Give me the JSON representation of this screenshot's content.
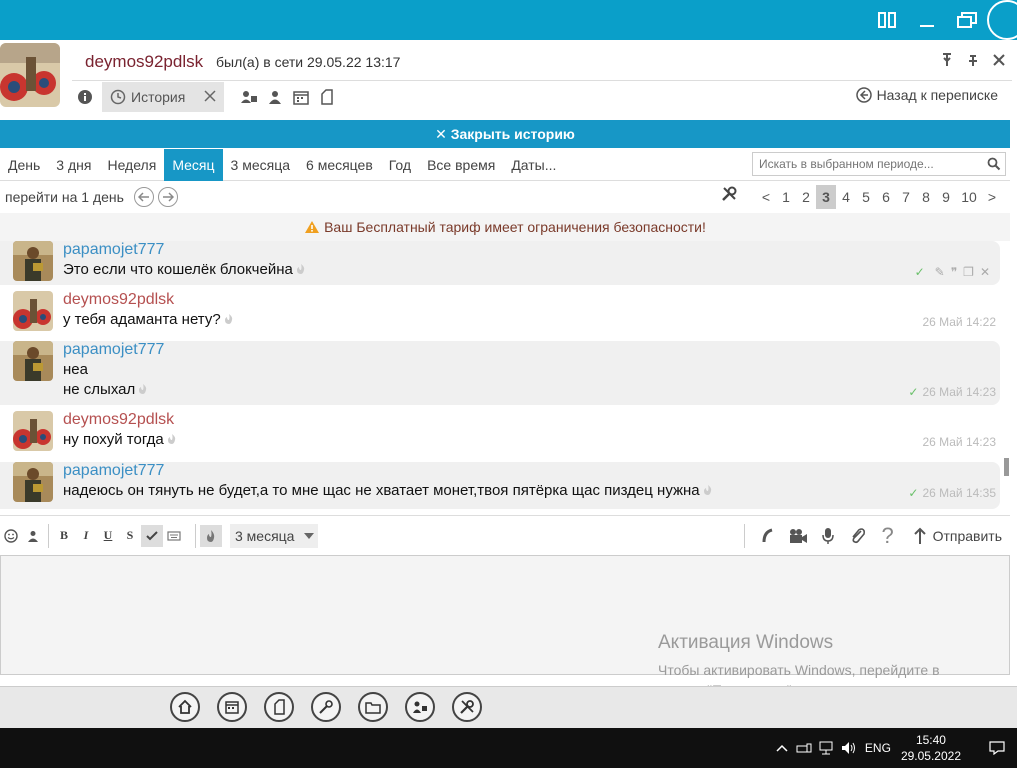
{
  "contact": {
    "name": "deymos92pdlsk",
    "status": "был(а) в сети 29.05.22 13:17"
  },
  "toolbar": {
    "history_tab": "История",
    "back_link": "Назад к переписке"
  },
  "history": {
    "close_label": "✕ Закрыть историю",
    "periods": [
      "День",
      "3 дня",
      "Неделя",
      "Месяц",
      "3 месяца",
      "6 месяцев",
      "Год",
      "Все время",
      "Даты..."
    ],
    "active_period": "Месяц",
    "search_placeholder": "Искать в выбранном периоде...",
    "goto_label": "перейти на 1 день",
    "pages": [
      "<",
      "1",
      "2",
      "3",
      "4",
      "5",
      "6",
      "7",
      "8",
      "9",
      "10",
      ">"
    ],
    "current_page": "3"
  },
  "warning": "Ваш Бесплатный тариф имеет ограничения безопасности!",
  "messages": [
    {
      "author": "papamojet777",
      "lines": [
        "Это если что кошелёк блокчейна"
      ],
      "time": "",
      "incoming": true
    },
    {
      "author": "deymos92pdlsk",
      "lines": [
        "у тебя адаманта нету?"
      ],
      "time": "26 Май 14:22",
      "incoming": false
    },
    {
      "author": "papamojet777",
      "lines": [
        "неа",
        "не слыхал"
      ],
      "time": "26 Май 14:23",
      "incoming": true
    },
    {
      "author": "deymos92pdlsk",
      "lines": [
        "ну похуй тогда"
      ],
      "time": "26 Май 14:23",
      "incoming": false
    },
    {
      "author": "papamojet777",
      "lines": [
        "надеюсь он тянуть не будет,а то мне щас не хватает монет,твоя пятёрка щас пиздец нужна"
      ],
      "time": "26 Май 14:35",
      "incoming": true
    }
  ],
  "composer": {
    "format_buttons": [
      "B",
      "I",
      "U",
      "S"
    ],
    "ttl_value": "3 месяца",
    "send_label": "Отправить"
  },
  "watermark": {
    "title": "Активация Windows",
    "text": "Чтобы активировать Windows, перейдите в раздел \"Параметры\"."
  },
  "taskbar": {
    "lang": "ENG",
    "time": "15:40",
    "date": "29.05.2022"
  },
  "colors": {
    "accent": "#1797c6",
    "titlebar": "#0a9fc9",
    "author_incoming": "#3b8fc4",
    "author_outgoing": "#b55050"
  }
}
